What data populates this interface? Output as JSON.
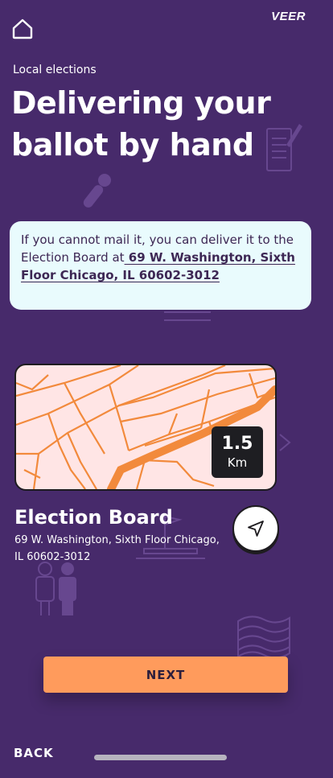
{
  "header": {
    "home_icon": "home-icon",
    "brand": "VEER"
  },
  "hero": {
    "eyebrow": "Local elections",
    "title_line1": "Delivering your",
    "title_line2": "ballot by hand"
  },
  "info": {
    "text": "If you cannot mail it, you can deliver it to the Election Board at",
    "address_link": " 69 W. Washington, Sixth Floor Chicago, IL 60602-3012"
  },
  "map": {
    "distance_value": "1.5",
    "distance_unit": "Km"
  },
  "place": {
    "name": "Election Board",
    "address": "69 W. Washington, Sixth Floor Chicago, IL 60602-3012",
    "nav_icon": "navigation-arrow-icon"
  },
  "actions": {
    "next_label": "NEXT",
    "back_label": "BACK"
  },
  "colors": {
    "background": "#472A6B",
    "card": "#E9FBFD",
    "map_bg": "#FFE5E5",
    "roads": "#F28A3C",
    "accent_button": "#FF9B5C"
  }
}
